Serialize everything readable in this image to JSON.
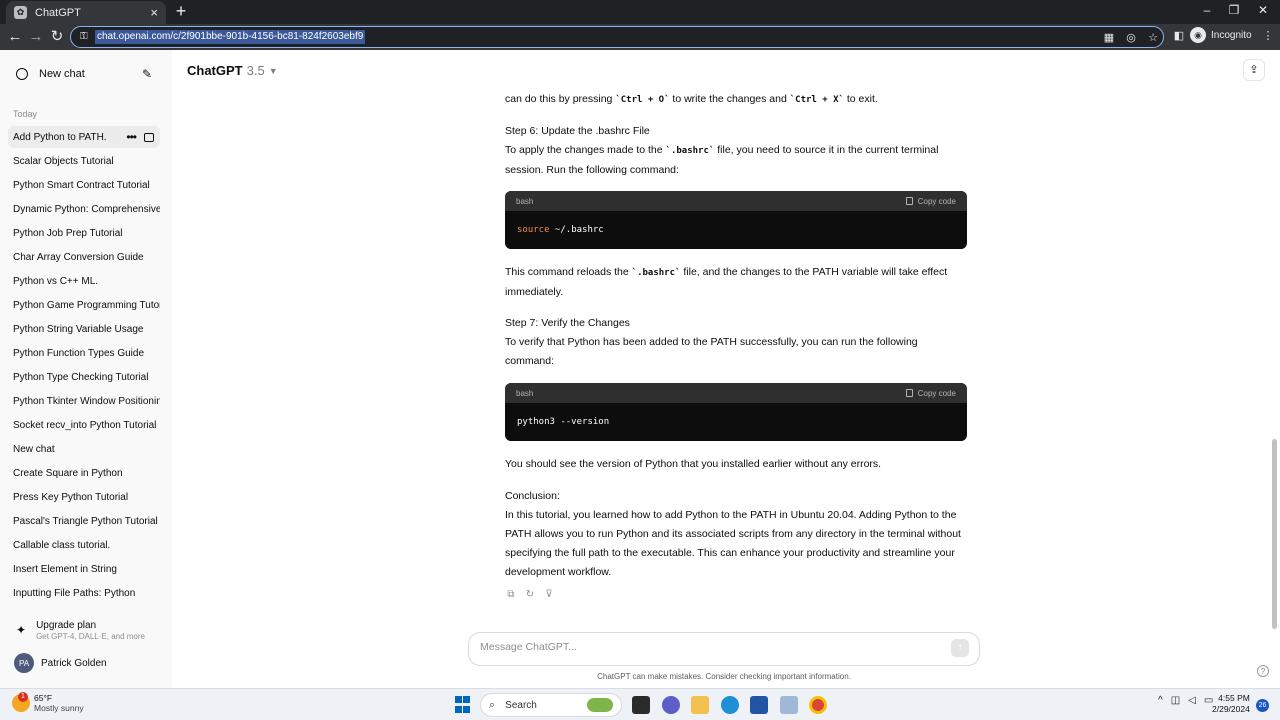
{
  "browser": {
    "tab_title": "ChatGPT",
    "url": "chat.openai.com/c/2f901bbe-901b-4156-bc81-824f2603ebf9",
    "profile_label": "Incognito"
  },
  "sidebar": {
    "new_chat_label": "New chat",
    "section_today": "Today",
    "history": [
      "Add Python to PATH.",
      "Scalar Objects Tutorial",
      "Python Smart Contract Tutorial",
      "Dynamic Python: Comprehensive",
      "Python Job Prep Tutorial",
      "Char Array Conversion Guide",
      "Python vs C++ ML.",
      "Python Game Programming Tutor",
      "Python String Variable Usage",
      "Python Function Types Guide",
      "Python Type Checking Tutorial",
      "Python Tkinter Window Positionin",
      "Socket recv_into Python Tutorial",
      "New chat",
      "Create Square in Python",
      "Press Key Python Tutorial",
      "Pascal's Triangle Python Tutorial",
      "Callable class tutorial.",
      "Insert Element in String",
      "Inputting File Paths: Python"
    ],
    "upgrade_title": "Upgrade plan",
    "upgrade_subtitle": "Get GPT-4, DALL·E, and more",
    "user_initials": "PA",
    "user_name": "Patrick Golden"
  },
  "header": {
    "model_name": "ChatGPT",
    "model_version": "3.5"
  },
  "message": {
    "p0_a": "can do this by pressing ",
    "p0_code1": "`Ctrl + O`",
    "p0_b": " to write the changes and ",
    "p0_code2": "`Ctrl + X`",
    "p0_c": " to exit.",
    "step6_title": "Step 6: Update the .bashrc File",
    "step6_a": "To apply the changes made to the ",
    "step6_code": "`.bashrc`",
    "step6_b": " file, you need to source it in the current terminal session. Run the following command:",
    "code1_lang": "bash",
    "code1_copy": "Copy code",
    "code1_kw": "source",
    "code1_rest": " ~/.bashrc",
    "after1_a": "This command reloads the ",
    "after1_code": "`.bashrc`",
    "after1_b": " file, and the changes to the PATH variable will take effect immediately.",
    "step7_title": "Step 7: Verify the Changes",
    "step7_text": "To verify that Python has been added to the PATH successfully, you can run the following command:",
    "code2_lang": "bash",
    "code2_copy": "Copy code",
    "code2_text": "python3 --version",
    "after2": "You should see the version of Python that you installed earlier without any errors.",
    "conclusion_title": "Conclusion:",
    "conclusion_text": "In this tutorial, you learned how to add Python to the PATH in Ubuntu 20.04. Adding Python to the PATH allows you to run Python and its associated scripts from any directory in the terminal without specifying the full path to the executable. This can enhance your productivity and streamline your development workflow."
  },
  "composer": {
    "placeholder": "Message ChatGPT...",
    "disclaimer": "ChatGPT can make mistakes. Consider checking important information."
  },
  "taskbar": {
    "weather_badge": "1",
    "temperature": "65°F",
    "condition": "Mostly sunny",
    "search_label": "Search",
    "time": "4:55 PM",
    "date": "2/29/2024",
    "notification_count": "26"
  },
  "colors": {
    "accent_omnibox_border": "#8ab4f8",
    "code_keyword": "#f08d49",
    "sidebar_bg": "#f9f9f9"
  }
}
